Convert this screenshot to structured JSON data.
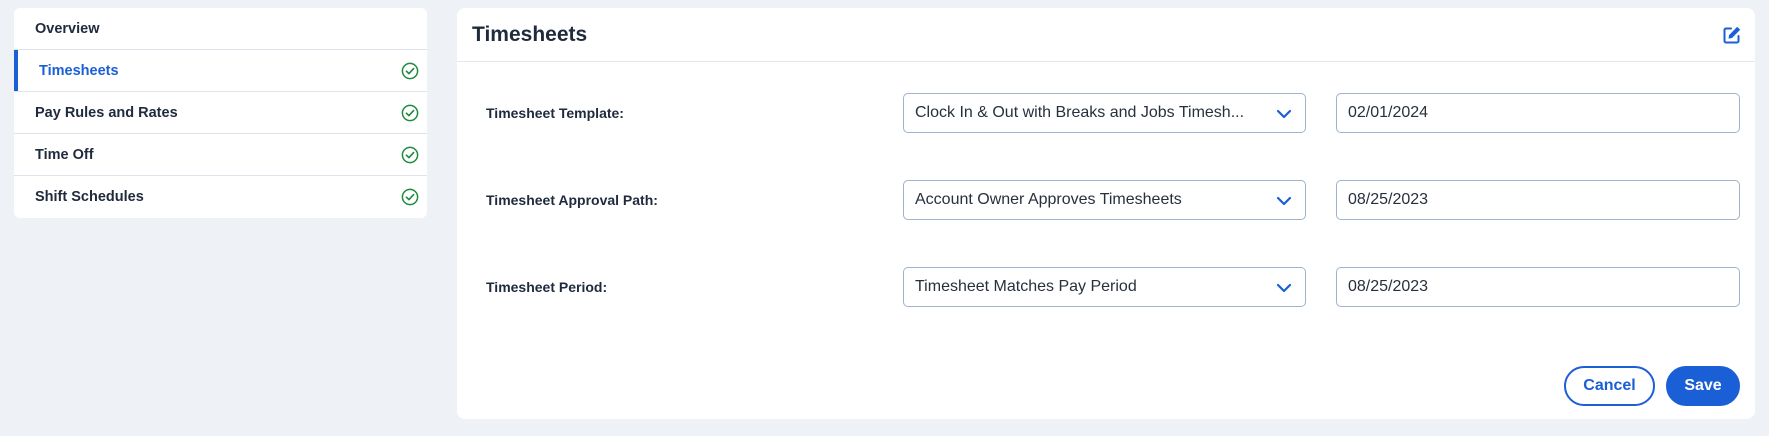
{
  "sidebar": {
    "items": [
      {
        "label": "Overview",
        "completed": false,
        "active": false
      },
      {
        "label": "Timesheets",
        "completed": true,
        "active": true
      },
      {
        "label": "Pay Rules and Rates",
        "completed": true,
        "active": false
      },
      {
        "label": "Time Off",
        "completed": true,
        "active": false
      },
      {
        "label": "Shift Schedules",
        "completed": true,
        "active": false
      }
    ],
    "check_icon": "check-circle-icon",
    "check_color": "#1e8a3c",
    "active_color": "#1a5fd6"
  },
  "panel": {
    "title": "Timesheets",
    "edit_icon": "edit-icon",
    "rows": [
      {
        "label": "Timesheet Template:",
        "select_value": "Clock In & Out with Breaks and Jobs Timesh...",
        "date": "02/01/2024"
      },
      {
        "label": "Timesheet Approval Path:",
        "select_value": "Account Owner Approves Timesheets",
        "date": "08/25/2023"
      },
      {
        "label": "Timesheet Period:",
        "select_value": "Timesheet Matches Pay Period",
        "date": "08/25/2023"
      }
    ],
    "chevron_icon": "chevron-down-icon"
  },
  "actions": {
    "cancel_label": "Cancel",
    "save_label": "Save",
    "primary_color": "#1a5fd6"
  }
}
